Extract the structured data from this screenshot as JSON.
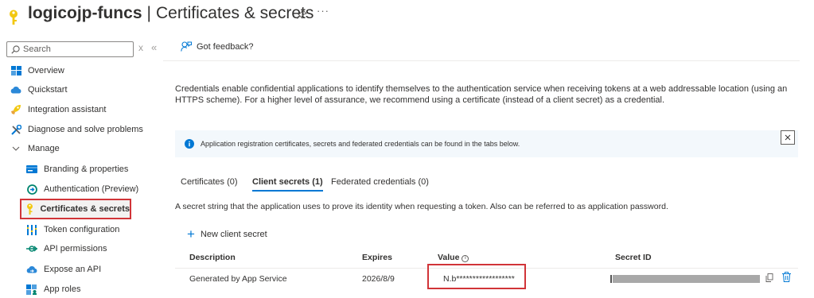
{
  "header": {
    "app_name": "logicojp-funcs",
    "separator": "|",
    "page_name": "Certificates & secrets",
    "more_label": "···"
  },
  "sidebar": {
    "search_placeholder": "Search",
    "clear_label": "x",
    "collapse_label": "«",
    "items": [
      {
        "label": "Overview",
        "icon": "overview-grid-icon"
      },
      {
        "label": "Quickstart",
        "icon": "cloud-icon"
      },
      {
        "label": "Integration assistant",
        "icon": "rocket-icon"
      },
      {
        "label": "Diagnose and solve problems",
        "icon": "wrench-icon"
      },
      {
        "label": "Manage",
        "icon": "chevron-down-icon"
      },
      {
        "label": "Branding & properties",
        "icon": "card-icon"
      },
      {
        "label": "Authentication (Preview)",
        "icon": "refresh-circle-icon"
      },
      {
        "label": "Certificates & secrets",
        "icon": "key-icon"
      },
      {
        "label": "Token configuration",
        "icon": "bars-icon"
      },
      {
        "label": "API permissions",
        "icon": "api-arrow-icon"
      },
      {
        "label": "Expose an API",
        "icon": "cloud-icon"
      },
      {
        "label": "App roles",
        "icon": "people-grid-icon"
      }
    ],
    "selected_label": "Certificates & secrets"
  },
  "main": {
    "feedback_label": "Got feedback?",
    "description": "Credentials enable confidential applications to identify themselves to the authentication service when receiving tokens at a web addressable location (using an HTTPS scheme). For a higher level of assurance, we recommend using a certificate (instead of a client secret) as a credential.",
    "info_message": "Application registration certificates, secrets and federated credentials can be found in the tabs below.",
    "tabs": [
      {
        "label": "Certificates (0)"
      },
      {
        "label": "Client secrets (1)"
      },
      {
        "label": "Federated credentials (0)"
      }
    ],
    "active_tab": "Client secrets (1)",
    "tab_description": "A secret string that the application uses to prove its identity when requesting a token. Also can be referred to as application password.",
    "new_secret_label": "New client secret",
    "table": {
      "headers": [
        "Description",
        "Expires",
        "Value",
        "Secret ID"
      ],
      "rows": [
        {
          "description": "Generated by App Service",
          "expires": "2026/8/9",
          "value": "N.b******************",
          "secret_id": ""
        }
      ]
    }
  },
  "colors": {
    "accent": "#0078d4",
    "highlight_border": "#d13438",
    "key_yellow": "#f2c811"
  }
}
